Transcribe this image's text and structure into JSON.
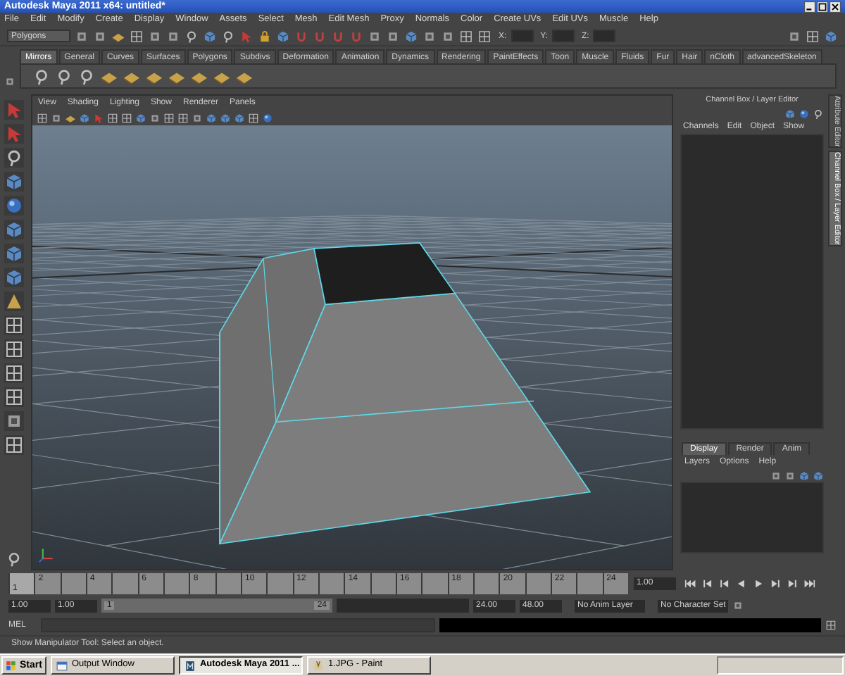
{
  "window": {
    "title": "Autodesk Maya 2011 x64: untitled*"
  },
  "menu_bar": [
    "File",
    "Edit",
    "Modify",
    "Create",
    "Display",
    "Window",
    "Assets",
    "Select",
    "Mesh",
    "Edit Mesh",
    "Proxy",
    "Normals",
    "Color",
    "Create UVs",
    "Edit UVs",
    "Muscle",
    "Help"
  ],
  "status_line": {
    "mode": "Polygons",
    "coords": [
      "X:",
      "Y:",
      "Z:"
    ]
  },
  "shelf_tabs": [
    {
      "label": "Mirrors",
      "selected": true
    },
    {
      "label": "General",
      "selected": false
    },
    {
      "label": "Curves",
      "selected": false
    },
    {
      "label": "Surfaces",
      "selected": false
    },
    {
      "label": "Polygons",
      "selected": false
    },
    {
      "label": "Subdivs",
      "selected": false
    },
    {
      "label": "Deformation",
      "selected": false
    },
    {
      "label": "Animation",
      "selected": false
    },
    {
      "label": "Dynamics",
      "selected": false
    },
    {
      "label": "Rendering",
      "selected": false
    },
    {
      "label": "PaintEffects",
      "selected": false
    },
    {
      "label": "Toon",
      "selected": false
    },
    {
      "label": "Muscle",
      "selected": false
    },
    {
      "label": "Fluids",
      "selected": false
    },
    {
      "label": "Fur",
      "selected": false
    },
    {
      "label": "Hair",
      "selected": false
    },
    {
      "label": "nCloth",
      "selected": false
    },
    {
      "label": "advancedSkeleton",
      "selected": false
    }
  ],
  "panel_menu": [
    "View",
    "Shading",
    "Lighting",
    "Show",
    "Renderer",
    "Panels"
  ],
  "channel_box": {
    "title": "Channel Box / Layer Editor",
    "menu": [
      "Channels",
      "Edit",
      "Object",
      "Show"
    ]
  },
  "layer_editor": {
    "tabs": [
      {
        "label": "Display",
        "selected": true
      },
      {
        "label": "Render",
        "selected": false
      },
      {
        "label": "Anim",
        "selected": false
      }
    ],
    "menu": [
      "Layers",
      "Options",
      "Help"
    ]
  },
  "side_tabs": [
    {
      "label": "Attribute Editor",
      "selected": false
    },
    {
      "label": "Channel Box / Layer Editor",
      "selected": true
    }
  ],
  "time_slider": {
    "level": 0.04,
    "current_frame": "1",
    "labels": [
      "2",
      "4",
      "6",
      "8",
      "10",
      "12",
      "14",
      "16",
      "18",
      "20",
      "22",
      "24"
    ],
    "current_time": "1.00"
  },
  "range_slider": {
    "start_time": "1.00",
    "playback_start": "1.00",
    "range_start": "1",
    "range_end": "24",
    "playback_end": "24.00",
    "end_time": "48.00",
    "anim_layer": "No Anim Layer",
    "character_set": "No Character Set"
  },
  "command_line": {
    "label": "MEL"
  },
  "help_line": "Show Manipulator Tool: Select an object.",
  "taskbar": {
    "start": "Start",
    "items": [
      {
        "label": "Output Window",
        "selected": false
      },
      {
        "label": "Autodesk Maya 2011 ...",
        "selected": true
      },
      {
        "label": "1.JPG - Paint",
        "selected": false
      }
    ]
  }
}
